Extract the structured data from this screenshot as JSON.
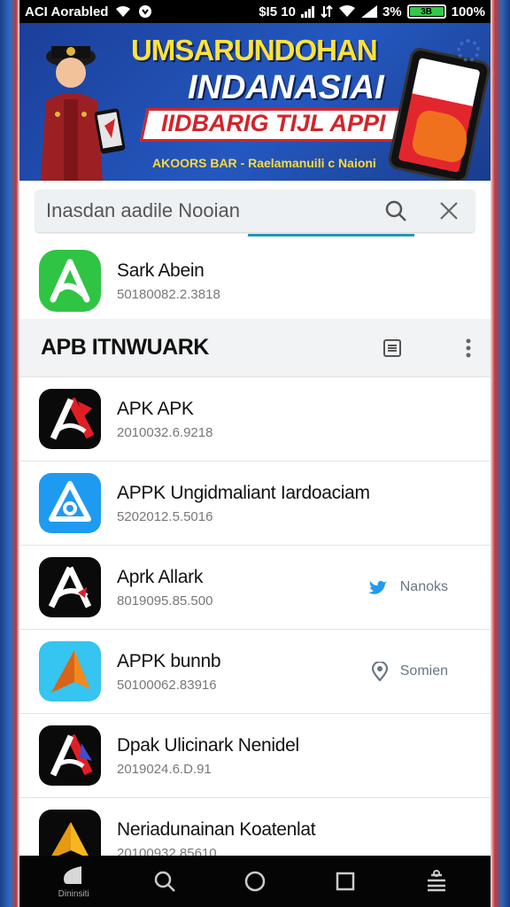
{
  "status_bar": {
    "left_text": "ACI Aorabled",
    "center_text": "$I5 10",
    "battery_percent": "3%",
    "battery_label": "3B",
    "signal_text": "100%"
  },
  "banner": {
    "title_line1": "UMSARUNDOHAN",
    "title_line2": "INDANASIAI",
    "ribbon_text": "IIDBARIG TIJL APPI",
    "subtitle": "AKOORS BAR - Raelamanuili c Naioni"
  },
  "search": {
    "placeholder": "Inasdan aadile Nooian"
  },
  "featured_app": {
    "name": "Sark Abein",
    "version": "50180082.2.3818",
    "icon_color": "#2fc443"
  },
  "section": {
    "title": "APB ITNWUARK"
  },
  "apps": [
    {
      "name": "APK APK",
      "version": "2010032.6.9218",
      "icon": "red-a-icon",
      "extra_label": ""
    },
    {
      "name": "APPK Ungidmaliant Iardoaciam",
      "version": "5202012.5.5016",
      "icon": "blue-a-icon",
      "extra_label": ""
    },
    {
      "name": "Aprk Allark",
      "version": "8019095.85.500",
      "icon": "white-a-icon",
      "extra_label": "Nanoks"
    },
    {
      "name": "APPK bunnb",
      "version": "50100062.83916",
      "icon": "orange-arrow-icon",
      "extra_label": "Somien"
    },
    {
      "name": "Dpak Ulicinark Nenidel",
      "version": "2019024.6.D.91",
      "icon": "red-a-icon",
      "extra_label": ""
    },
    {
      "name": "Neriadunainan Koatenlat",
      "version": "20100932.85610",
      "icon": "yellow-arrow-icon",
      "extra_label": ""
    }
  ],
  "nav": {
    "home_label": "Dininsiti"
  },
  "colors": {
    "accent": "#2196b6",
    "brand_blue": "#1b3f99",
    "brand_red": "#d2242b",
    "banner_yellow": "#ffe23b"
  }
}
